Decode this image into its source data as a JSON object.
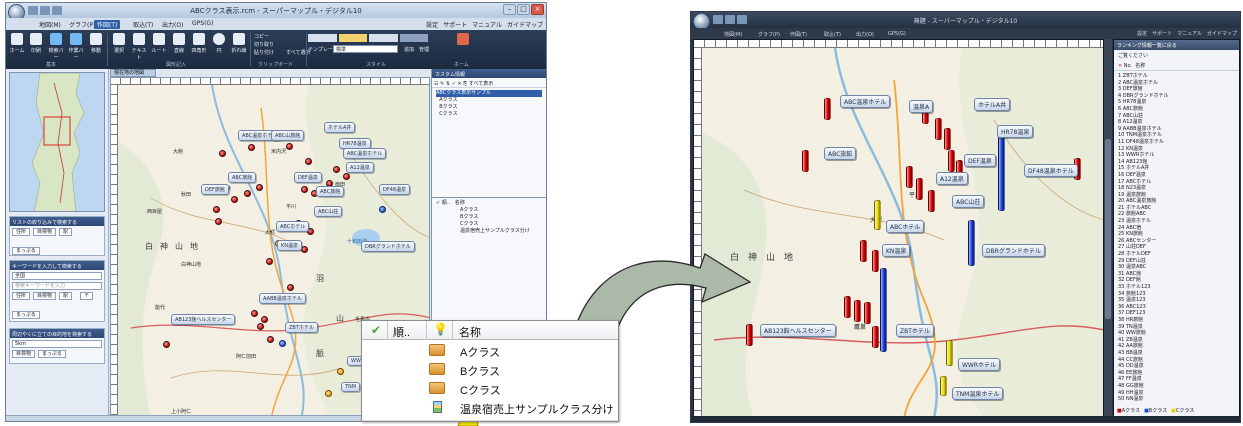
{
  "left_window": {
    "title": "ABCクラス表示.rcm - スーパーマップル・デジタル10",
    "menu": [
      "地図(M)",
      "グラフ(P)",
      "作図(T)",
      "取込(T)",
      "出力(O)",
      "GPS(G)"
    ],
    "menu_help": [
      "設定",
      "サポート",
      "マニュアル",
      "ガイドマップ"
    ],
    "ribbon_buttons": [
      "ホーム",
      "印刷",
      "検索バー",
      "作業バー",
      "移動",
      "選択",
      "テキスト",
      "ルート",
      "直線",
      "四角形",
      "円",
      "折れ線",
      "ラベル"
    ],
    "ribbon_groups": [
      "基本",
      "図形記入",
      "クリップボード",
      "スタイル",
      "ホーム"
    ],
    "clipboard_items": [
      "コピー",
      "切り取り",
      "貼り付け",
      "すべて選択"
    ],
    "template_label": "テンプレート",
    "template_value": "標準",
    "ribbon_right": [
      "追加",
      "管理"
    ],
    "map_tab": "現在地の地図",
    "side_sections": [
      {
        "title": "リストの絞り込みで検索する",
        "buttons": [
          "住所",
          "目標物",
          "駅",
          "まっぷる"
        ]
      },
      {
        "title": "キーワードを入力して検索する",
        "select": "全国",
        "placeholder": "検索キーワードを入力",
        "buttons": [
          "住所",
          "目標物",
          "駅",
          "〒",
          "まっぷる"
        ]
      },
      {
        "title": "周辺やくに立ての目的地を検索する",
        "select": "5km",
        "buttons": [
          "目標物",
          "まっぷる"
        ]
      }
    ],
    "layer_panel": {
      "title": "カスタム情報",
      "toolbar_text": "すべて表示",
      "tree": [
        "ABCクラス表示サンプル",
        "Aクラス",
        "Bクラス",
        "Cクラス"
      ],
      "lower_header": [
        "順..",
        "名称"
      ],
      "lower_rows": [
        "Aクラス",
        "Bクラス",
        "Cクラス",
        "温泉宿売上サンプルクラス分け"
      ]
    },
    "map_labels": [
      "ホテルA井",
      "ABC温泉ホテル",
      "ABC山旅館",
      "HR78温泉",
      "A12温泉",
      "DEF旅館",
      "ABC旅館",
      "ABC温泉ホテル",
      "DEF温泉",
      "DF48温泉",
      "ABC旅館",
      "ABC山荘",
      "ABCホテル",
      "KN温泉",
      "DBRグランドホテル",
      "AABB温泉ホテル",
      "AB123館ヘルスセンター",
      "ZBTホテル",
      "WWR",
      "TNM"
    ],
    "map_texts": [
      "白神山地",
      "十和田湖",
      "西目屋",
      "大鰐",
      "扇田",
      "鷹巣",
      "平川",
      "毛馬内",
      "上小阿仁",
      "能代",
      "秋田",
      "大館",
      "米内沢",
      "阿仁前田"
    ],
    "map_big": [
      "白",
      "神",
      "山",
      "地"
    ],
    "map_big2": [
      "羽",
      "山",
      "脈"
    ]
  },
  "callout": {
    "header": {
      "order": "順..",
      "name": "名称"
    },
    "rows": [
      {
        "icon": "folder-icon",
        "label": "Aクラス"
      },
      {
        "icon": "folder-icon",
        "label": "Bクラス"
      },
      {
        "icon": "folder-icon",
        "label": "Cクラス"
      },
      {
        "icon": "layer-icon",
        "label": "温泉宿売上サンプルクラス分け"
      }
    ]
  },
  "right_window": {
    "title": "無題 - スーパーマップル・デジタル10",
    "menu": [
      "地図(M)",
      "グラフ(P)",
      "作図(T)",
      "取込(T)",
      "出力(O)",
      "GPS(G)"
    ],
    "menu_help": [
      "設定",
      "サポート",
      "マニュアル",
      "ガイドマップ"
    ],
    "list_title": "ランキング情報一覧に戻る",
    "list_sub": "ご覧ください",
    "list_header": [
      "No.",
      "名称"
    ],
    "list_rows": [
      "1 ZBTホテル",
      "2 ABC温泉ホテル",
      "3 DEF旅館",
      "4 DBRグランドホテル",
      "5 HR78温泉",
      "6 ABC旅館",
      "7 ABC山荘",
      "8 A12温泉",
      "9 AABB温泉ホテル",
      "10 TNM温泉ホテル",
      "11 DF48温泉ホテル",
      "12 KN温泉",
      "13 WWRホテル",
      "14 AB123館",
      "15 ホテルA井",
      "16 DEF温泉",
      "17 ABCホテル",
      "18 N23温泉",
      "19 温泉旅館",
      "20 ABC温泉旅館",
      "21 ホテルABC",
      "22 旅館ABC",
      "23 温泉ホテル",
      "24 ABC宿",
      "25 KN旅館",
      "26 ABCセンター",
      "27 山荘DEF",
      "28 ホテルDEF",
      "29 DEF山荘",
      "30 温泉ABC",
      "31 ABC館",
      "32 DEF館",
      "33 ホテル123",
      "34 旅館123",
      "35 温泉123",
      "36 ABC123",
      "37 DEF123",
      "38 HR旅館",
      "39 TN温泉",
      "40 WW旅館",
      "41 ZB温泉",
      "42 AA旅館",
      "43 BB温泉",
      "44 CC旅館",
      "45 DD温泉",
      "46 EE旅館",
      "47 FF温泉",
      "48 GG旅館",
      "49 HH温泉",
      "50 NN温泉"
    ],
    "legend": [
      "Aクラス",
      "Bクラス",
      "Cクラス"
    ],
    "map_labels": [
      "ABC温泉ホテル",
      "温泉A",
      "ホテルA井",
      "ABC旅館",
      "HR78温泉",
      "DEF温泉",
      "DF48温泉ホテル",
      "A12温泉",
      "ABC山荘",
      "ABCホテル",
      "DBRグランドホテル",
      "KN温泉",
      "AB123館ヘルスセンター",
      "ZBTホテル",
      "WWRホテル",
      "TNM温泉ホテル"
    ],
    "map_texts": [
      "白神山地",
      "大鰐",
      "平川",
      "鷹巣"
    ]
  },
  "colors": {
    "class_a": "#c00000",
    "class_b": "#1c4fc9",
    "class_c": "#e7d800",
    "arrow_fill": "#aab9a8",
    "pointer": "#f5e400"
  }
}
